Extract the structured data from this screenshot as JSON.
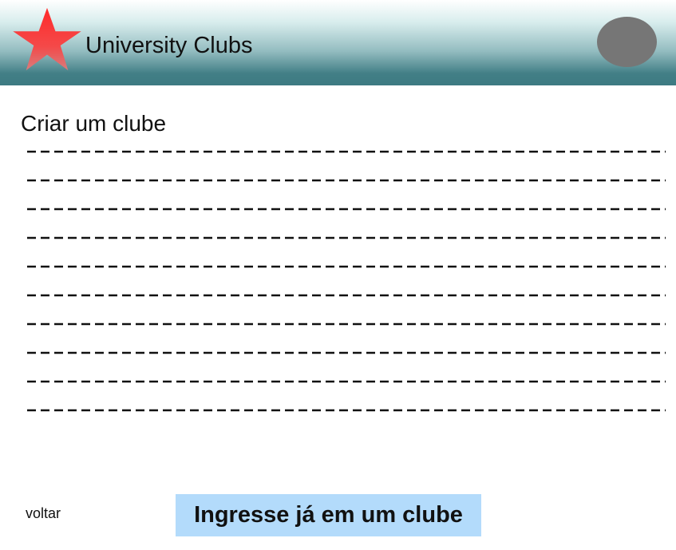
{
  "header": {
    "logo_icon": "red-star-icon",
    "title": "University Clubs",
    "avatar_icon": "user-avatar-icon",
    "colors": {
      "gradient_top": "#ffffff",
      "gradient_bottom": "#3d7a82",
      "star": "#ff2a2a",
      "avatar": "#767676"
    }
  },
  "main": {
    "heading": "Criar um clube",
    "placeholder_line_count": 10
  },
  "footer": {
    "back_label": "voltar",
    "join_label": "Ingresse já em um clube",
    "join_button_color": "#b3dbfb"
  }
}
